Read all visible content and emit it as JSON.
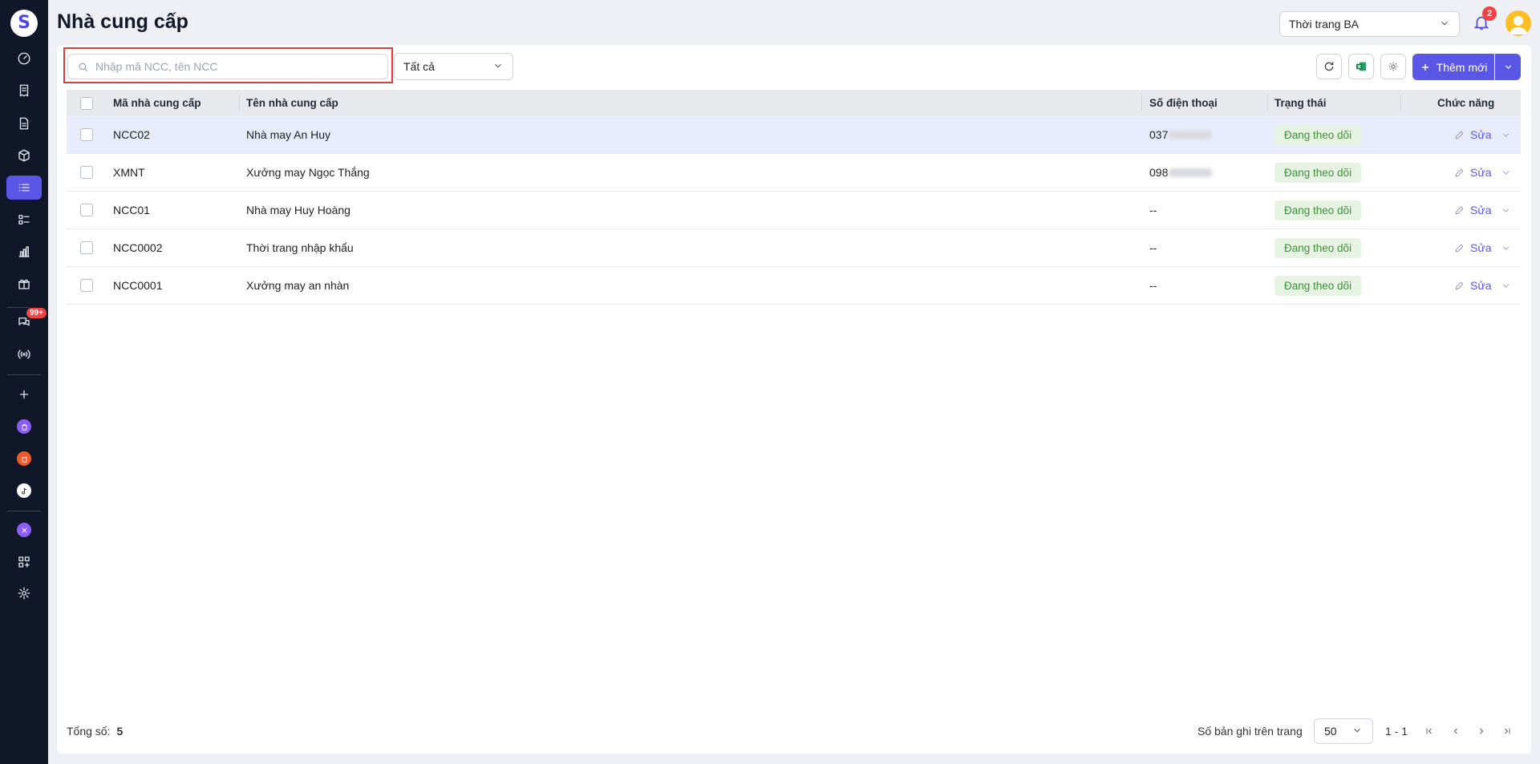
{
  "header": {
    "title": "Nhà cung cấp",
    "shop_select": "Thời trang BA",
    "notification_count": "2"
  },
  "sidebar": {
    "chat_badge": "99+"
  },
  "toolbar": {
    "search_placeholder": "Nhập mã NCC, tên NCC",
    "filter_value": "Tất cả",
    "add_label": "Thêm mới"
  },
  "table": {
    "columns": {
      "code": "Mã nhà cung cấp",
      "name": "Tên nhà cung cấp",
      "phone": "Số điện thoại",
      "status": "Trạng thái",
      "actions": "Chức năng"
    },
    "rows": [
      {
        "code": "NCC02",
        "name": "Nhà may An Huy",
        "phone": "037",
        "status": "Đang theo dõi",
        "action": "Sửa"
      },
      {
        "code": "XMNT",
        "name": "Xưởng may Ngọc Thắng",
        "phone": "098",
        "status": "Đang theo dõi",
        "action": "Sửa"
      },
      {
        "code": "NCC01",
        "name": "Nhà may Huy Hoàng",
        "phone": "--",
        "status": "Đang theo dõi",
        "action": "Sửa"
      },
      {
        "code": "NCC0002",
        "name": "Thời trang nhập khẩu",
        "phone": "--",
        "status": "Đang theo dõi",
        "action": "Sửa"
      },
      {
        "code": "NCC0001",
        "name": "Xưởng may an nhàn",
        "phone": "--",
        "status": "Đang theo dõi",
        "action": "Sửa"
      }
    ]
  },
  "footer": {
    "total_label": "Tổng số:",
    "total_value": "5",
    "per_page_label": "Số bản ghi trên trang",
    "per_page_value": "50",
    "range": "1 - 1"
  },
  "colors": {
    "accent": "#5b57e6",
    "sidebar_bg": "#0f1729",
    "status_bg": "#e7f4e4",
    "status_text": "#3f8f3a",
    "highlight_outline": "#e03b3b"
  }
}
